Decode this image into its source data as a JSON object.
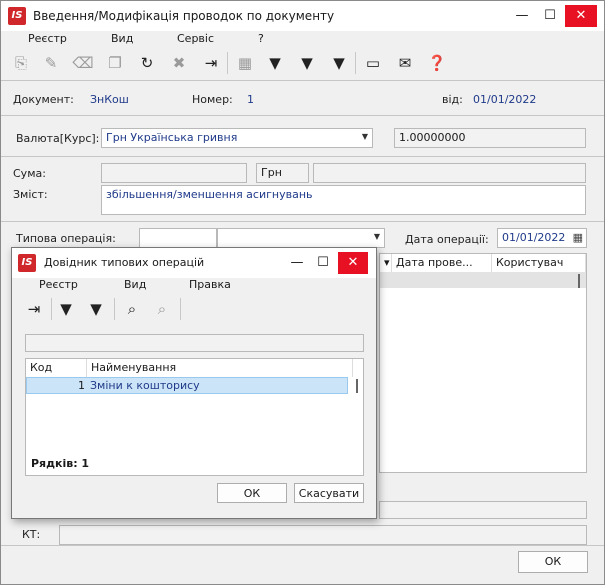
{
  "window": {
    "title": "Введення/Модифікація проводок по документу",
    "logo": "IS",
    "menu": [
      "Реєстр",
      "Вид",
      "Сервіс",
      "?"
    ]
  },
  "toolbar_icons": [
    "add-doc-icon",
    "edit-doc-icon",
    "delete-doc-icon",
    "copy-icon",
    "refresh-icon",
    "delete-icon",
    "exit-icon",
    "grid-icon",
    "filter-icon",
    "filter-set-icon",
    "filter-clear-icon",
    "card-icon",
    "mail-icon",
    "help-icon"
  ],
  "doc": {
    "doc_label": "Документ:",
    "doc_value": "ЗнКош",
    "num_label": "Номер:",
    "num_value": "1",
    "date_label": "від:",
    "date_value": "01/01/2022"
  },
  "currency": {
    "label": "Валюта[Курс]:",
    "value": "Грн Українська гривня",
    "rate": "1.00000000"
  },
  "sum": {
    "label": "Сума:",
    "currency": "Грн"
  },
  "content": {
    "label": "Зміст:",
    "value": "збільшення/зменшення асигнувань"
  },
  "operation": {
    "label": "Типова операція:",
    "date_label": "Дата операції:",
    "date_value": "01/01/2022"
  },
  "grid_cols": [
    "Дата прове...",
    "Користувач"
  ],
  "kt_label": "КТ:",
  "ok_label": "ОК",
  "dialog": {
    "title": "Довідник типових операцій",
    "logo": "IS",
    "menu": [
      "Реєстр",
      "Вид",
      "Правка"
    ],
    "cols": {
      "code": "Код",
      "name": "Найменування"
    },
    "rows": [
      {
        "code": "1",
        "name": "Зміни к кошторису"
      }
    ],
    "count_label": "Рядків: 1",
    "ok": "ОК",
    "cancel": "Скасувати"
  }
}
